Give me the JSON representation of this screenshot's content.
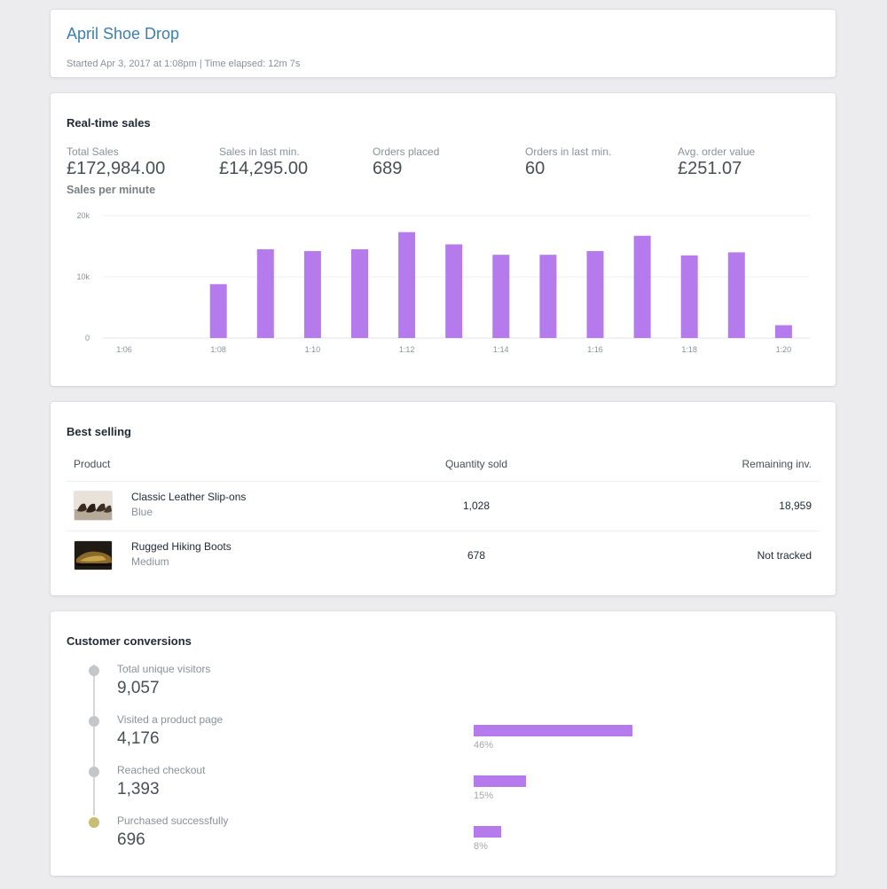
{
  "header": {
    "title": "April Shoe Drop",
    "meta": "Started Apr 3, 2017 at 1:08pm | Time elapsed: 12m 7s"
  },
  "sales": {
    "heading": "Real-time sales",
    "metrics": [
      {
        "label": "Total Sales",
        "value": "£172,984.00"
      },
      {
        "label": "Sales in last min.",
        "value": "£14,295.00"
      },
      {
        "label": "Orders placed",
        "value": "689"
      },
      {
        "label": "Orders in last min.",
        "value": "60"
      },
      {
        "label": "Avg. order value",
        "value": "£251.07"
      }
    ],
    "chart_title": "Sales per minute"
  },
  "chart_data": {
    "type": "bar",
    "title": "Sales per minute",
    "xlabel": "",
    "ylabel": "",
    "ylim": [
      0,
      20000
    ],
    "yticks": [
      "0",
      "10k",
      "20k"
    ],
    "xticks": [
      "1:06",
      "1:08",
      "1:10",
      "1:12",
      "1:14",
      "1:16",
      "1:18",
      "1:20"
    ],
    "categories": [
      "1:06",
      "1:07",
      "1:08",
      "1:09",
      "1:10",
      "1:11",
      "1:12",
      "1:13",
      "1:14",
      "1:15",
      "1:16",
      "1:17",
      "1:18",
      "1:19",
      "1:20"
    ],
    "values": [
      0,
      0,
      8800,
      14500,
      14200,
      14500,
      17300,
      15300,
      13600,
      13600,
      14200,
      16700,
      13500,
      14000,
      2100
    ],
    "bar_color": "#b57bec",
    "grid": true
  },
  "best_selling": {
    "heading": "Best selling",
    "columns": [
      "Product",
      "Quantity sold",
      "Remaining inv."
    ],
    "rows": [
      {
        "name": "Classic Leather Slip-ons",
        "variant": "Blue",
        "qty": "1,028",
        "inventory": "18,959",
        "thumb": "shoes-photo"
      },
      {
        "name": "Rugged Hiking Boots",
        "variant": "Medium",
        "qty": "678",
        "inventory": "Not tracked",
        "thumb": "boots-photo"
      }
    ]
  },
  "conversions": {
    "heading": "Customer conversions",
    "steps": [
      {
        "label": "Total unique visitors",
        "value": "9,057"
      },
      {
        "label": "Visited a product page",
        "value": "4,176",
        "percent": "46%",
        "fraction": 0.46
      },
      {
        "label": "Reached checkout",
        "value": "1,393",
        "percent": "15%",
        "fraction": 0.15
      },
      {
        "label": "Purchased successfully",
        "value": "696",
        "percent": "8%",
        "fraction": 0.08
      }
    ],
    "bar_color": "#b57bec"
  }
}
